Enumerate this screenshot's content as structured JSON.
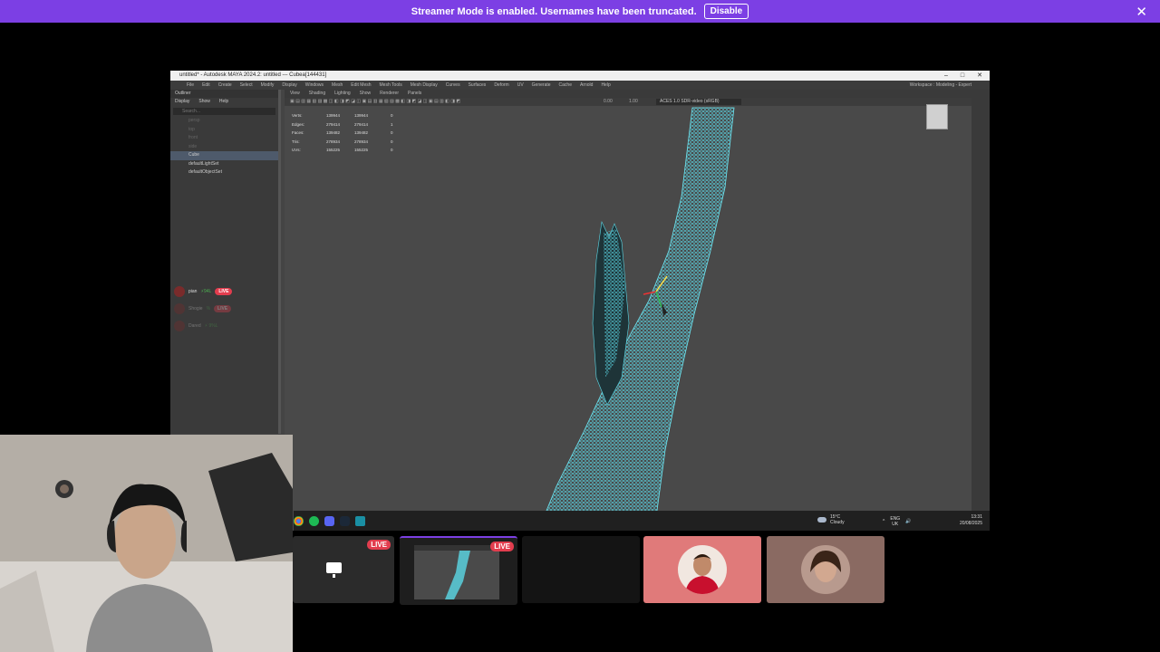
{
  "banner": {
    "message": "Streamer Mode is enabled. Usernames have been truncated.",
    "disable_label": "Disable",
    "close_glyph": "✕"
  },
  "window": {
    "title": "untitled* - Autodesk MAYA 2024.2: untitled  ---  Cubea[144431]",
    "controls": [
      "–",
      "□",
      "✕"
    ]
  },
  "maya": {
    "menu": [
      "File",
      "Edit",
      "Create",
      "Select",
      "Modify",
      "Display",
      "Windows",
      "Mesh",
      "Edit Mesh",
      "Mesh Tools",
      "Mesh Display",
      "Curves",
      "Surfaces",
      "Deform",
      "UV",
      "Generate",
      "Cache",
      "Arnold",
      "Help"
    ],
    "workspace_label": "Workspace :",
    "workspace_value": "Modeling - Expert",
    "outliner": {
      "title": "Outliner",
      "menu": [
        "Display",
        "Show",
        "Help"
      ],
      "search_placeholder": "Search...",
      "items": [
        {
          "label": "persp",
          "dim": true
        },
        {
          "label": "top",
          "dim": true
        },
        {
          "label": "front",
          "dim": true
        },
        {
          "label": "side",
          "dim": true
        },
        {
          "label": "Cube",
          "selected": true
        },
        {
          "label": "defaultLightSet"
        },
        {
          "label": "defaultObjectSet"
        }
      ]
    },
    "viewport_menu": [
      "View",
      "Shading",
      "Lighting",
      "Show",
      "Renderer",
      "Panels"
    ],
    "colorspace": "ACES 1.0 SDR-video (sRGB)",
    "exposure": "0.00",
    "gamma": "1.00",
    "hud": [
      {
        "label": "Verts:",
        "a": "139944",
        "b": "139944",
        "c": "0"
      },
      {
        "label": "Edges:",
        "a": "279414",
        "b": "279414",
        "c": "1"
      },
      {
        "label": "Faces:",
        "a": "139482",
        "b": "139482",
        "c": "0"
      },
      {
        "label": "Tris:",
        "a": "278934",
        "b": "278934",
        "c": "0"
      },
      {
        "label": "UVs:",
        "a": "155225",
        "b": "155225",
        "c": "0"
      }
    ]
  },
  "call_participants": [
    {
      "name": "pian",
      "percent": "⚡94L",
      "badge": "LIVE"
    },
    {
      "name": "Shogie",
      "percent": "%",
      "badge": "LIVE"
    },
    {
      "name": "Dared",
      "percent": "⚡ 9%L",
      "badge": ""
    }
  ],
  "taskbar": {
    "weather_temp": "15°C",
    "weather_desc": "Cloudy",
    "lang": "ENG",
    "region": "UK",
    "time": "13:31",
    "date": "20/08/2025"
  },
  "tiles": [
    {
      "type": "screen",
      "live": "LIVE",
      "bg": "#2b2b2b"
    },
    {
      "type": "stream",
      "live": "LIVE",
      "bg": "#1e1e1e"
    },
    {
      "type": "empty",
      "bg": "#141414"
    },
    {
      "type": "avatar",
      "bg": "#e07a7a"
    },
    {
      "type": "avatar2",
      "bg": "#8a6a62"
    }
  ],
  "colors": {
    "banner": "#7c3fe4",
    "live": "#e23d4e",
    "wireframe": "#5ad8e6"
  }
}
